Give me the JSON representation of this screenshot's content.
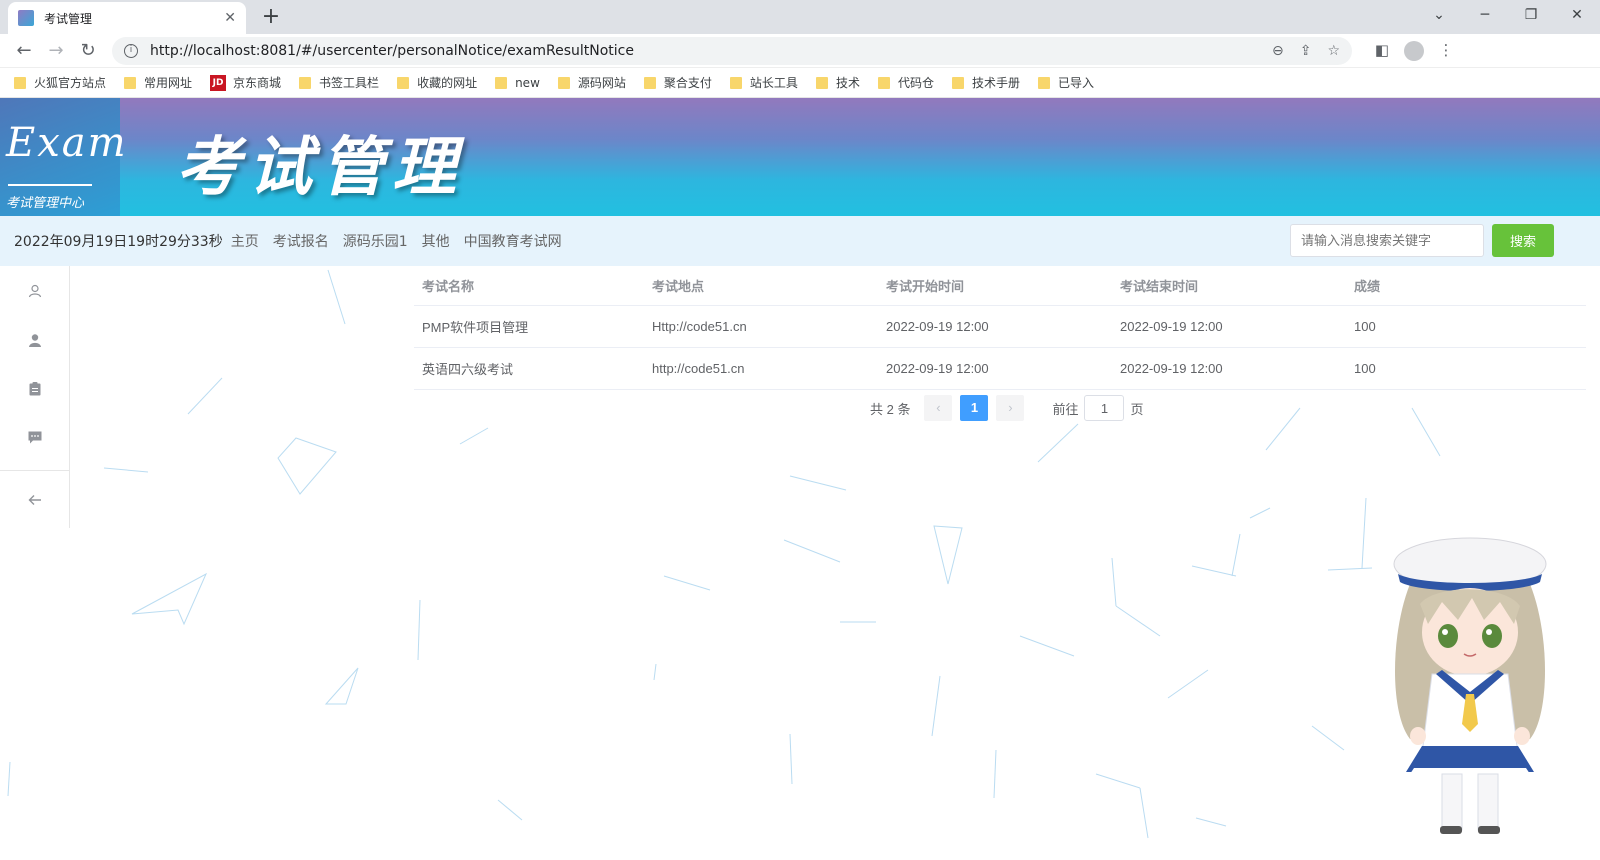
{
  "browser": {
    "tab_title": "考试管理",
    "url": "http://localhost:8081/#/usercenter/personalNotice/examResultNotice",
    "bookmarks": [
      "火狐官方站点",
      "常用网址",
      "京东商城",
      "书签工具栏",
      "收藏的网址",
      "new",
      "源码网站",
      "聚合支付",
      "站长工具",
      "技术",
      "代码仓",
      "技术手册",
      "已导入"
    ],
    "jd_badge": "JD"
  },
  "header": {
    "logo_word": "Exam",
    "logo_sub": "考试管理中心",
    "title": "考试管理"
  },
  "nav": {
    "clock": "2022年09月19日19时29分33秒",
    "links": [
      "主页",
      "考试报名",
      "源码乐园1",
      "其他",
      "中国教育考试网"
    ],
    "search_placeholder": "请输入消息搜索关键字",
    "search_button": "搜索"
  },
  "sidebar": {
    "icons": [
      "user-outline-icon",
      "user-filled-icon",
      "clipboard-icon",
      "message-icon",
      "back-arrow-icon"
    ]
  },
  "table": {
    "columns": [
      "考试名称",
      "考试地点",
      "考试开始时间",
      "考试结束时间",
      "成绩"
    ],
    "rows": [
      [
        "PMP软件项目管理",
        "Http://code51.cn",
        "2022-09-19 12:00",
        "2022-09-19 12:00",
        "100"
      ],
      [
        "英语四六级考试",
        "http://code51.cn",
        "2022-09-19 12:00",
        "2022-09-19 12:00",
        "100"
      ]
    ]
  },
  "pagination": {
    "total": "共 2 条",
    "current": "1",
    "goto_label": "前往",
    "goto_value": "1",
    "page_suffix": "页"
  }
}
